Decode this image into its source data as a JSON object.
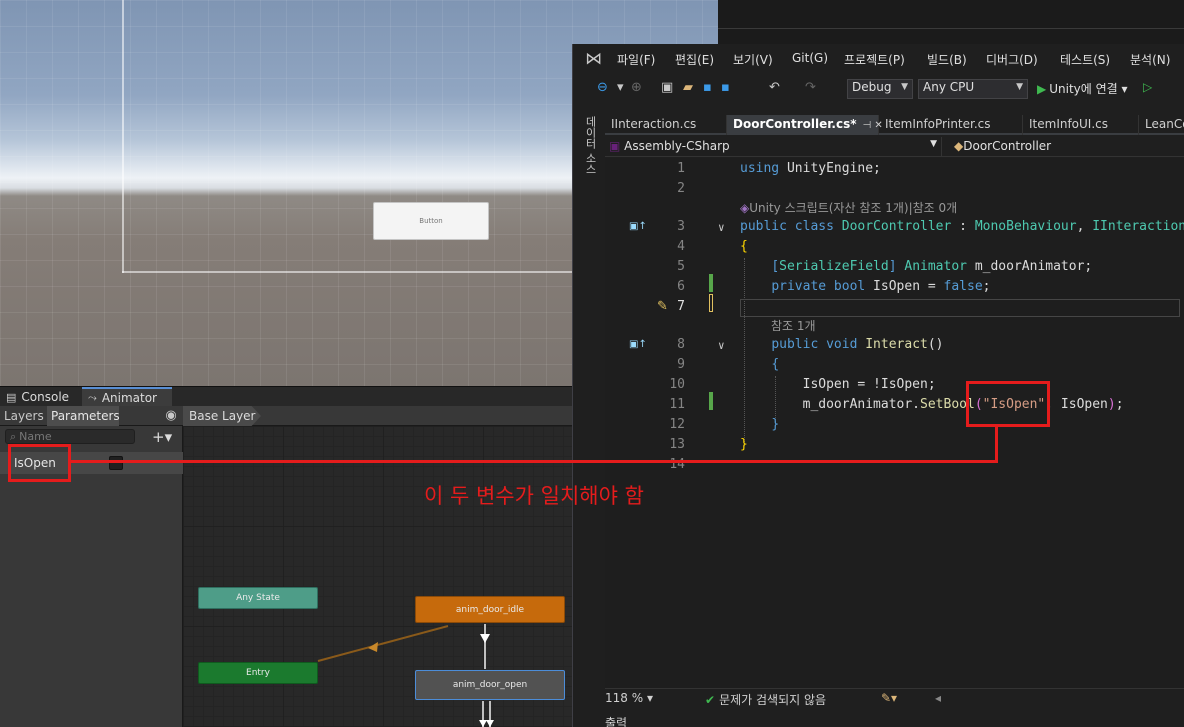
{
  "scene": {
    "button_label": "Button"
  },
  "unity": {
    "tabs": [
      "Console",
      "Animator"
    ],
    "animator": {
      "subtabs": [
        "Layers",
        "Parameters"
      ],
      "breadcrumb": "Base Layer",
      "search_placeholder": "Name",
      "add_glyph": "+▾",
      "parameters": [
        {
          "name": "IsOpen",
          "type": "bool"
        }
      ],
      "nodes": {
        "any_state": "Any State",
        "entry": "Entry",
        "idle": "anim_door_idle",
        "open": "anim_door_open"
      },
      "colors": {
        "any_state": "#4e9d88",
        "entry": "#1b7a2e",
        "default_state": "#c66a0c",
        "selected_state": "#525252"
      }
    }
  },
  "vs": {
    "menu": [
      "파일(F)",
      "편집(E)",
      "보기(V)",
      "Git(G)",
      "프로젝트(P)",
      "빌드(B)",
      "디버그(D)",
      "테스트(S)",
      "분석(N)"
    ],
    "toolbar": {
      "configuration": "Debug",
      "platform": "Any CPU",
      "run_label": "Unity에 연결"
    },
    "side_panel_label": "데이터 소스",
    "doc_tabs": [
      "IInteraction.cs",
      "DoorController.cs*",
      "ItemInfoPrinter.cs",
      "ItemInfoUI.cs",
      "LeanCo"
    ],
    "active_tab_index": 1,
    "nav": {
      "project": "Assembly-CSharp",
      "class": "DoorController"
    },
    "code_lens": {
      "class": "Unity 스크립트(자산 참조 1개)|참조 0개",
      "method": "참조 1개"
    },
    "line_numbers": [
      "1",
      "2",
      "3",
      "4",
      "5",
      "6",
      "7",
      "8",
      "9",
      "10",
      "11",
      "12",
      "13",
      "14"
    ],
    "status": {
      "zoom": "118 %",
      "message": "문제가 검색되지 않음"
    },
    "bottom_panel": "출력"
  },
  "annotation": {
    "text": "이 두 변수가 일치해야 함",
    "color": "#e51c1c"
  }
}
